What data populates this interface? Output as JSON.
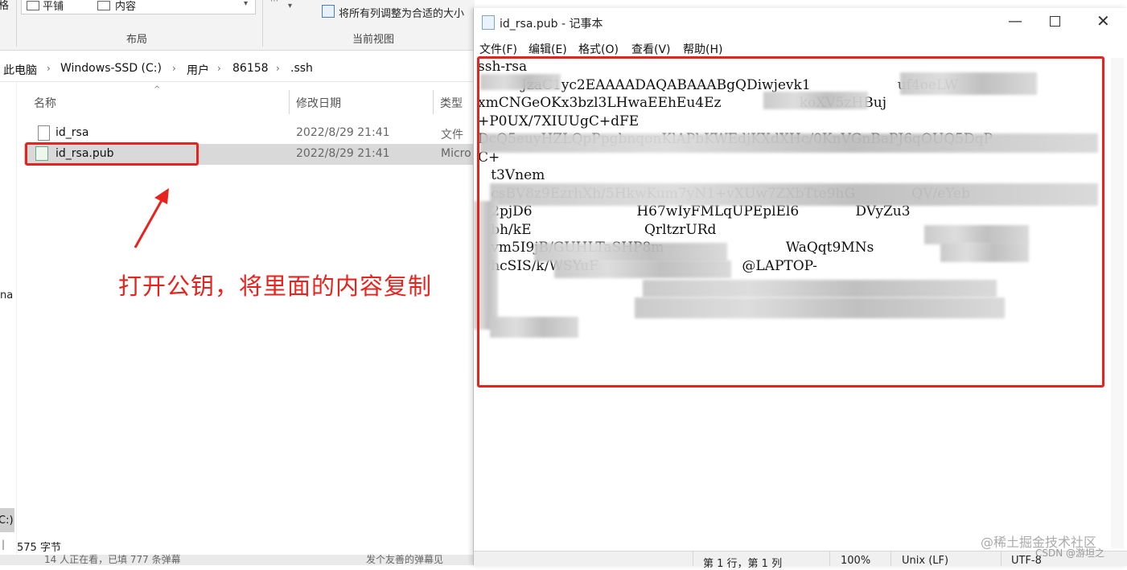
{
  "ribbon": {
    "tile_label": "平铺",
    "content_label": "内容",
    "layout_group": "布局",
    "autofit_label": "将所有列调整为合适的大小",
    "current_view_group": "当前视图",
    "left_partial": "格"
  },
  "breadcrumb": [
    "此电脑",
    "Windows-SSD (C:)",
    "用户",
    "86158",
    ".ssh"
  ],
  "columns": {
    "name": "名称",
    "date": "修改日期",
    "type": "类型"
  },
  "files": [
    {
      "name": "id_rsa",
      "date": "2022/8/29 21:41",
      "type": "文件"
    },
    {
      "name": "id_rsa.pub",
      "date": "2022/8/29 21:41",
      "type": "Micro"
    }
  ],
  "sidebar": {
    "partial_1": "na",
    "partial_2": "C:)"
  },
  "explorer_status": "575 字节",
  "annotation": "打开公钥，将里面的内容复制",
  "bottom_partial": "14 人正在看，已填 777 条弹幕",
  "bottom_partial_2": "发个友善的弹幕见",
  "notepad": {
    "title": "id_rsa.pub - 记事本",
    "menus": [
      "文件(F)",
      "编辑(E)",
      "格式(O)",
      "查看(V)",
      "帮助(H)"
    ],
    "text_lines": [
      "ssh-rsa",
      "          JzaC1yc2EAAAADAQABAAABgQDiwjevk1                    uf4oeLW",
      "xmCNGeOKx3bzl3LHwaEEhEu4Ez                  koXV5zHBuj",
      "+P0UX/7XIUUgC+dFE",
      "",
      "DcQ5euyHZLQpPpgbnqonKlAPbKWEdjKXdXHc/0KnVGnBaPJ6qOUQ5DqP",
      "C+",
      "",
      "   t3Vnem",
      "   csBV8z9EzrhXh/5HkwKum7yN1+vXUw7ZXbTte9hG             QV/eYeb",
      "   2pjD6                        H67wIyFMLqUPEplEl6             DVyZu3",
      "   bh/kE                          QrltzrURd",
      "   vm5I9jB/GUHLTaSHP8m                            WaQqt9MNs",
      "   hcSIS/k/WSYuF                                 @LAPTOP-"
    ],
    "status": [
      "第 1 行，第 1 列",
      "100%",
      "Unix (LF)",
      "UTF-8"
    ],
    "window_controls": [
      "minimize-icon",
      "maximize-icon",
      "close-icon"
    ]
  },
  "watermark": "@稀土掘金技术社区",
  "watermark_2": "CSDN @游坦之",
  "colors": {
    "highlight_red": "#e8221d",
    "selection_gray": "#d9d9d9"
  }
}
